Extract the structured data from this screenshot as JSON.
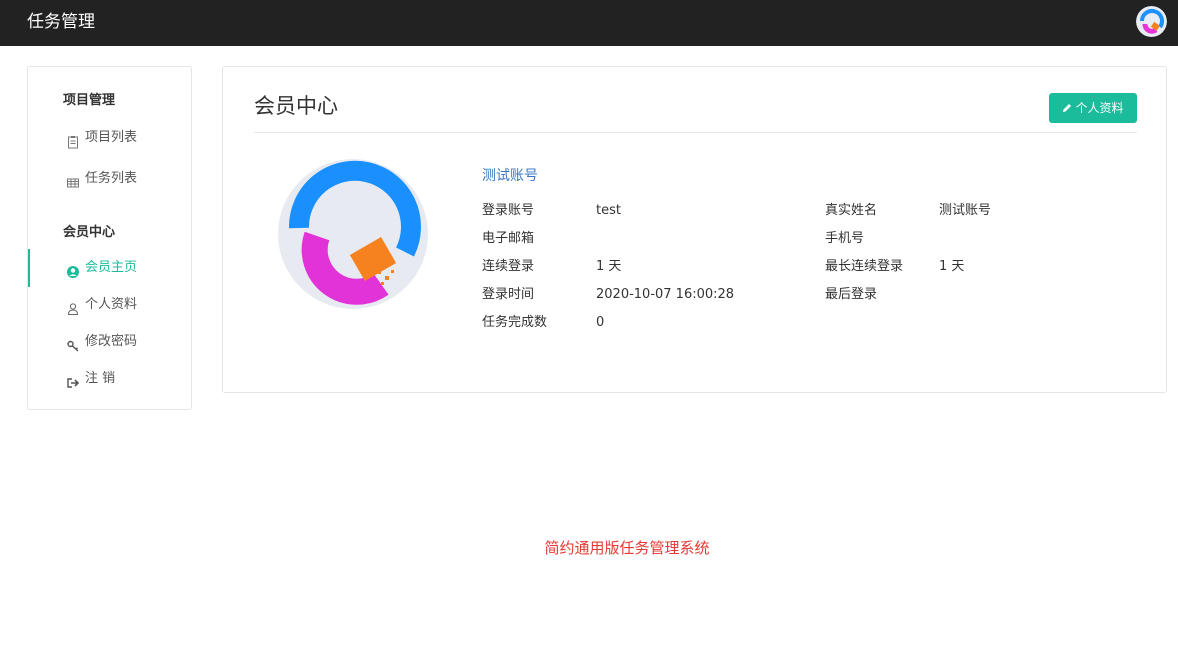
{
  "header": {
    "brand": "任务管理",
    "user_avatar_icon": "app-logo-icon"
  },
  "sidebar": {
    "section1_title": "项目管理",
    "section1_items": [
      {
        "label": "项目列表",
        "icon": "clipboard-icon"
      },
      {
        "label": "任务列表",
        "icon": "table-icon"
      }
    ],
    "section2_title": "会员中心",
    "section2_items": [
      {
        "label": "会员主页",
        "icon": "user-circle-icon",
        "active": true
      },
      {
        "label": "个人资料",
        "icon": "user-icon"
      },
      {
        "label": "修改密码",
        "icon": "key-icon"
      },
      {
        "label": "注 销",
        "icon": "sign-out-icon"
      }
    ]
  },
  "main": {
    "title": "会员中心",
    "profile_button": "个人资料",
    "account_display_name": "测试账号",
    "fields_left": [
      {
        "label": "登录账号",
        "value": "test"
      },
      {
        "label": "电子邮箱",
        "value": ""
      },
      {
        "label": "连续登录",
        "value": "1 天"
      },
      {
        "label": "登录时间",
        "value": "2020-10-07 16:00:28"
      },
      {
        "label": "任务完成数",
        "value": "0"
      }
    ],
    "fields_right": [
      {
        "label": "真实姓名",
        "value": "测试账号"
      },
      {
        "label": "手机号",
        "value": ""
      },
      {
        "label": "最长连续登录",
        "value": "1 天"
      },
      {
        "label": "最后登录",
        "value": ""
      }
    ]
  },
  "footer": {
    "text": "简约通用版任务管理系统"
  },
  "colors": {
    "accent": "#1abc9c",
    "topbar": "#222222",
    "link": "#3a78c3",
    "footer": "#e53935"
  }
}
